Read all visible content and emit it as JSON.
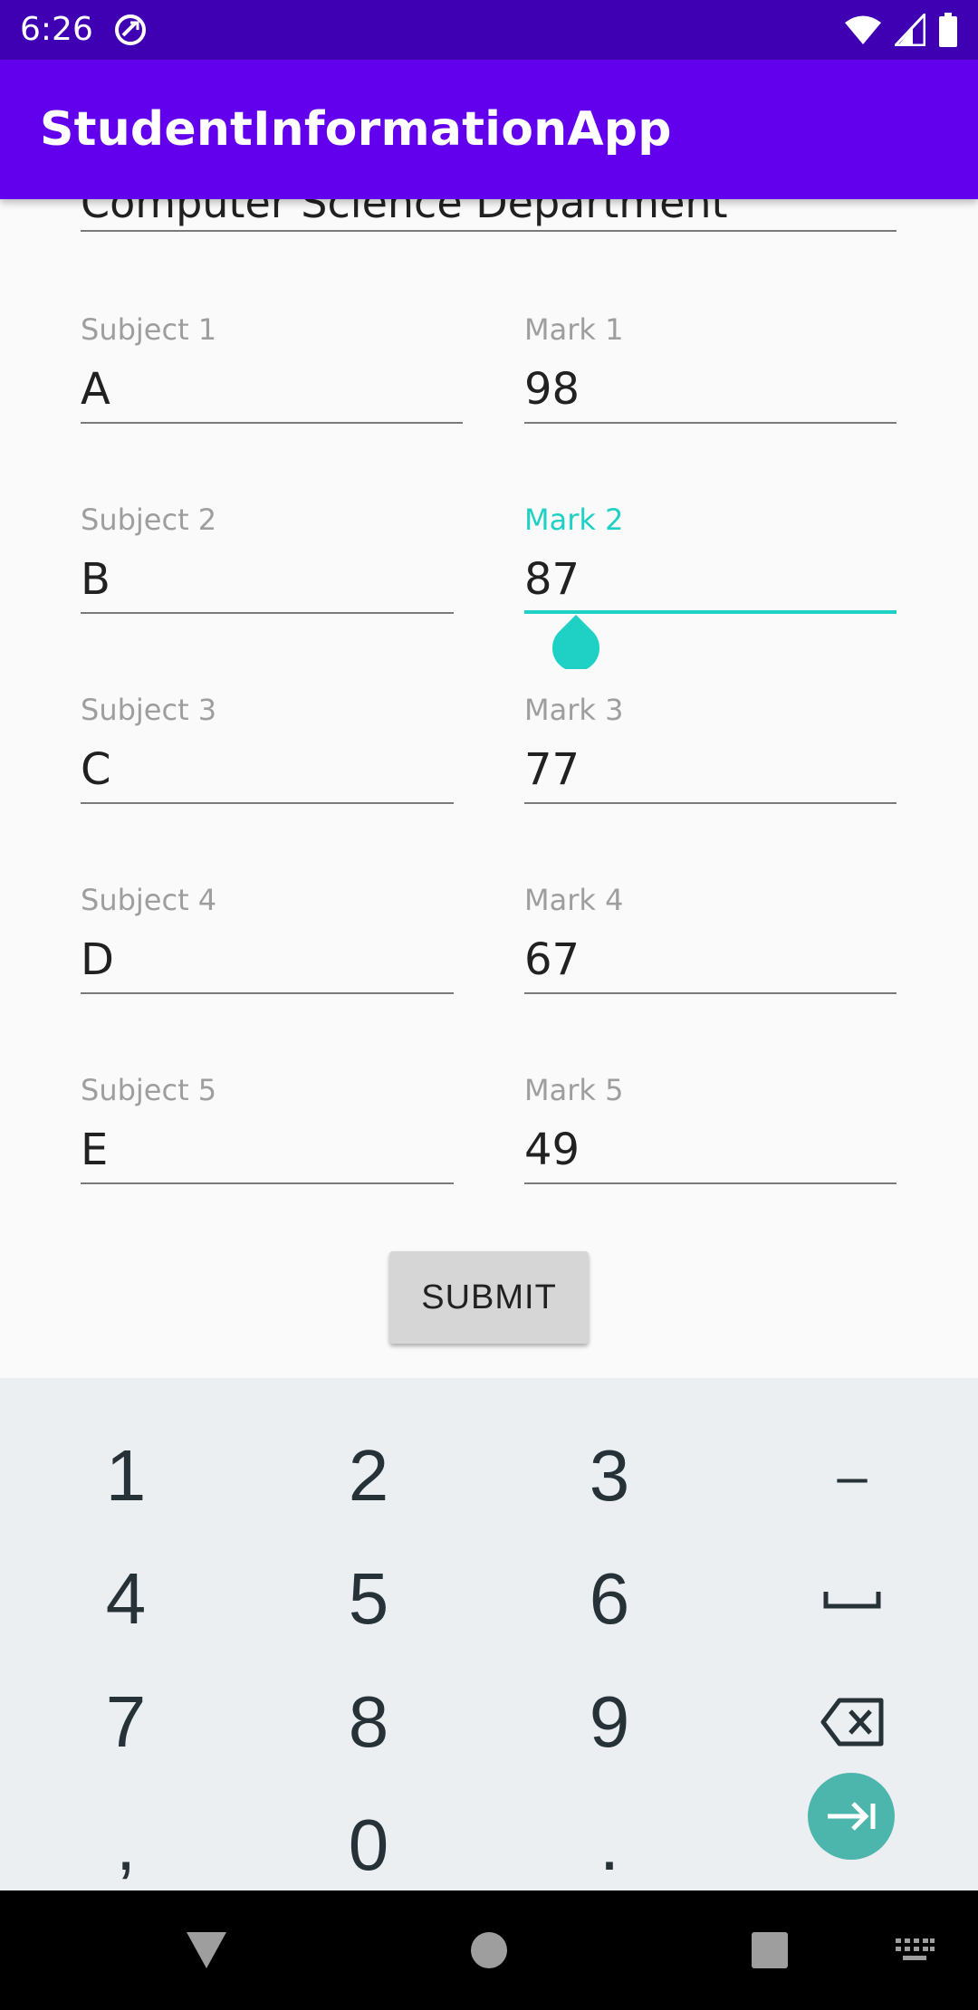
{
  "status_bar": {
    "time": "6:26",
    "icons": [
      "sync-icon",
      "wifi-icon",
      "signal-icon",
      "battery-icon"
    ]
  },
  "app_bar": {
    "title": "StudentInformationApp",
    "color": "#6200ee"
  },
  "form": {
    "department": {
      "value": "Computer Science Department"
    },
    "rows": [
      {
        "subject_label": "Subject 1",
        "subject_value": "A",
        "mark_label": "Mark 1",
        "mark_value": "98"
      },
      {
        "subject_label": "Subject 2",
        "subject_value": "B",
        "mark_label": "Mark 2",
        "mark_value": "87"
      },
      {
        "subject_label": "Subject 3",
        "subject_value": "C",
        "mark_label": "Mark 3",
        "mark_value": "77"
      },
      {
        "subject_label": "Subject 4",
        "subject_value": "D",
        "mark_label": "Mark 4",
        "mark_value": "67"
      },
      {
        "subject_label": "Subject 5",
        "subject_value": "E",
        "mark_label": "Mark 5",
        "mark_value": "49"
      }
    ],
    "focused_field": "Mark 2",
    "accent_color": "#1fd1c4",
    "submit_label": "SUBMIT"
  },
  "keyboard": {
    "keys": [
      "1",
      "2",
      "3",
      "–",
      "4",
      "5",
      "6",
      "7",
      "8",
      "9",
      ",",
      "0",
      "."
    ],
    "special_keys": [
      "space-icon",
      "backspace-icon",
      "tab-next-icon"
    ]
  },
  "nav_bar": {
    "icons": [
      "back-icon",
      "home-icon",
      "recents-icon",
      "keyboard-switch-icon"
    ]
  }
}
